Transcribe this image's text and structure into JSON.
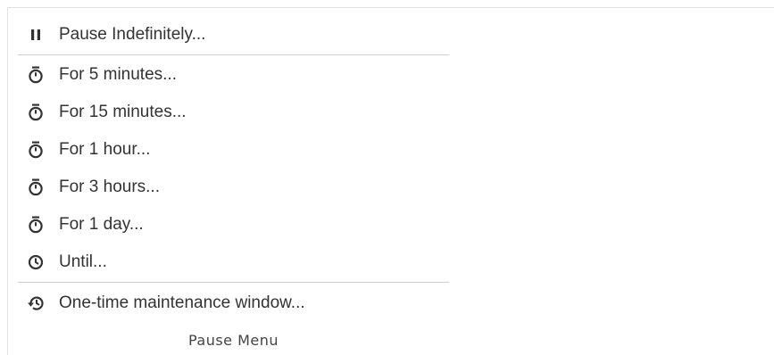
{
  "menu": {
    "items": [
      {
        "label": "Pause Indefinitely...",
        "icon": "pause-icon"
      },
      {
        "label": "For 5 minutes...",
        "icon": "stopwatch-icon"
      },
      {
        "label": "For 15 minutes...",
        "icon": "stopwatch-icon"
      },
      {
        "label": "For 1 hour...",
        "icon": "stopwatch-icon"
      },
      {
        "label": "For 3 hours...",
        "icon": "stopwatch-icon"
      },
      {
        "label": "For 1 day...",
        "icon": "stopwatch-icon"
      },
      {
        "label": "Until...",
        "icon": "clock-icon"
      },
      {
        "label": "One-time maintenance window...",
        "icon": "history-icon"
      }
    ]
  },
  "caption": "Pause Menu",
  "colors": {
    "text": "#333333",
    "divider": "#cfcfcf",
    "background": "#ffffff"
  }
}
